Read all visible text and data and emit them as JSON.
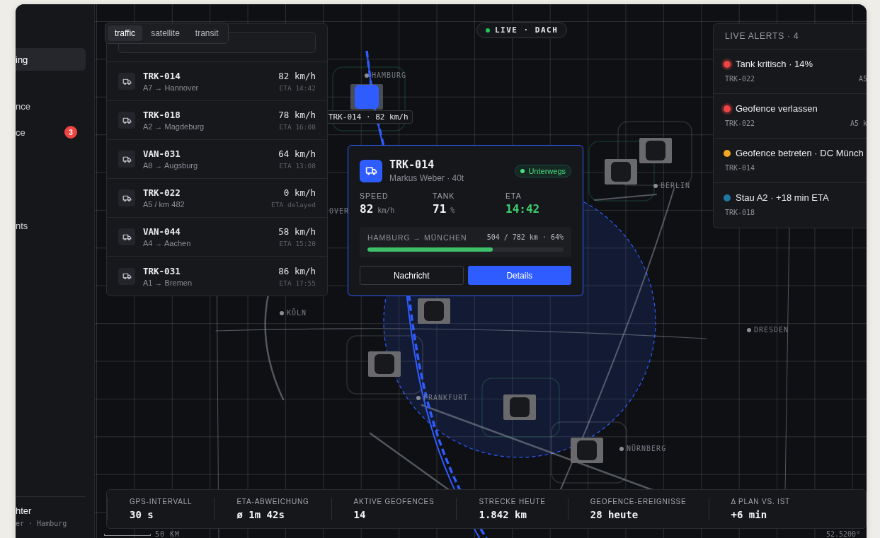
{
  "sidebar": {
    "items": [
      {
        "label": "ing",
        "selected": true
      },
      {
        "label": "nce",
        "selected": false
      },
      {
        "label": "ce",
        "selected": false,
        "badge": "3"
      },
      {
        "label": "nts",
        "selected": false
      }
    ],
    "user": {
      "name": "hter",
      "meta": "er · Hamburg"
    }
  },
  "map": {
    "live_badge": "LIVE · DACH",
    "cities": [
      "HAMBURG",
      "OVER",
      "BERLIN",
      "KÖLN",
      "DRESDEN",
      "FRANKFURT",
      "NÜRNBERG"
    ],
    "markers": [
      {
        "selected": true
      },
      {
        "selected": false
      },
      {
        "selected": false
      },
      {
        "selected": false
      },
      {
        "selected": false
      },
      {
        "selected": false
      },
      {
        "selected": false
      }
    ],
    "marker_label": "TRK-014 · 82 km/h",
    "scale": "50 KM",
    "coordinates": "52.5200°"
  },
  "map_tabs": [
    {
      "label": "traffic",
      "selected": true
    },
    {
      "label": "satellite",
      "selected": false
    },
    {
      "label": "transit",
      "selected": false
    }
  ],
  "vehicles": [
    {
      "id": "TRK-014",
      "route": "A7 → Hannover",
      "speed": "82 km/h",
      "eta": "ETA 14:42"
    },
    {
      "id": "TRK-018",
      "route": "A2 → Magdeburg",
      "speed": "78 km/h",
      "eta": "ETA 16:08"
    },
    {
      "id": "VAN-031",
      "route": "A8 → Augsburg",
      "speed": "64 km/h",
      "eta": "ETA 13:08"
    },
    {
      "id": "TRK-022",
      "route": "A5 / km 482",
      "speed": "0 km/h",
      "eta": "ETA delayed"
    },
    {
      "id": "VAN-044",
      "route": "A4 → Aachen",
      "speed": "58 km/h",
      "eta": "ETA 15:20"
    },
    {
      "id": "TRK-031",
      "route": "A1 → Bremen",
      "speed": "86 km/h",
      "eta": "ETA 17:55"
    }
  ],
  "popup": {
    "id": "TRK-014",
    "subtitle": "Markus Weber · 40t",
    "status": "Unterwegs",
    "stats": [
      {
        "label": "SPEED",
        "value": "82",
        "unit": "km/h",
        "accent": false
      },
      {
        "label": "TANK",
        "value": "71",
        "unit": "%",
        "accent": false
      },
      {
        "label": "ETA",
        "value": "14:42",
        "accent": true
      }
    ],
    "trip": {
      "route": "HAMBURG → MÜNCHEN",
      "progress": "504 / 782 km · 64%",
      "level": 0.64
    },
    "buttons": [
      {
        "label": "Nachricht",
        "kind": "secondary"
      },
      {
        "label": "Details",
        "kind": "primary"
      }
    ]
  },
  "alerts": {
    "title": "LIVE ALERTS · 4",
    "items": [
      {
        "title": "Tank kritisch · 14%",
        "vehicle": "TRK-022",
        "location": "A5",
        "color": "#ef4444",
        "critical": true
      },
      {
        "title": "Geofence verlassen",
        "vehicle": "TRK-022",
        "location": "A5 k",
        "color": "#ef4444",
        "critical": true
      },
      {
        "title": "Geofence betreten · DC Münch",
        "vehicle": "TRK-014",
        "color": "#f5a623",
        "critical": false
      },
      {
        "title": "Stau A2 · +18 min ETA",
        "vehicle": "TRK-018",
        "color": "#1f78a4",
        "critical": false
      }
    ]
  },
  "stats": [
    {
      "label": "GPS-INTERVALL",
      "value": "30 s"
    },
    {
      "label": "ETA-ABWEICHUNG",
      "value": "ø 1m 42s"
    },
    {
      "label": "AKTIVE GEOFENCES",
      "value": "14"
    },
    {
      "label": "STRECKE HEUTE",
      "value": "1.842 km"
    },
    {
      "label": "GEOFENCE-EREIGNISSE",
      "value": "28 heute"
    },
    {
      "label": "Δ PLAN VS. IST",
      "value": "+6 min"
    }
  ]
}
